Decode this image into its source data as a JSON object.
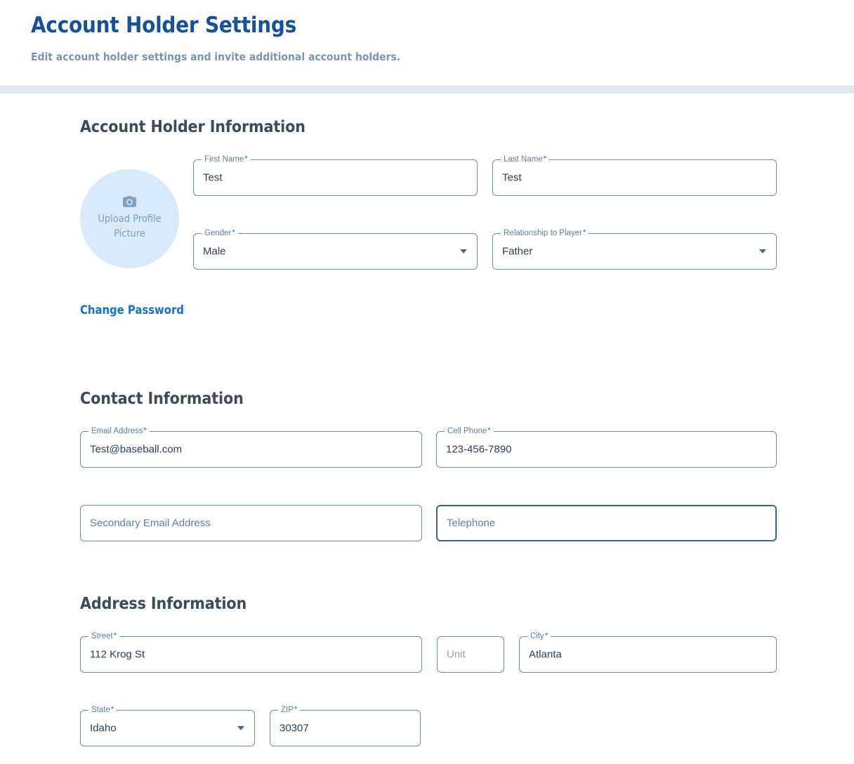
{
  "header": {
    "title": "Account Holder Settings",
    "subtitle": "Edit account holder settings and invite additional account holders.",
    "title_color": "#16529b",
    "subtitle_color": "#7b93ab",
    "band_color": "#e2e8f1"
  },
  "sections": {
    "account_holder": {
      "title": "Account Holder Information"
    },
    "contact": {
      "title": "Contact Information"
    },
    "address": {
      "title": "Address Information"
    }
  },
  "avatar": {
    "caption": "Upload Profile Picture",
    "icon": "camera-icon",
    "bg_color": "#daeafa",
    "text_color": "#7ca0c0"
  },
  "links": {
    "change_password": "Change Password",
    "color": "#1172d4"
  },
  "required_marker": "*",
  "fields": {
    "first_name": {
      "label": "First Name",
      "required": true,
      "value": "Test",
      "placeholder": "",
      "type": "text",
      "focused": false
    },
    "last_name": {
      "label": "Last Name",
      "required": true,
      "value": "Test",
      "placeholder": "",
      "type": "text",
      "focused": false
    },
    "gender": {
      "label": "Gender",
      "required": true,
      "value": "Male",
      "placeholder": "",
      "type": "select",
      "focused": false
    },
    "relationship": {
      "label": "Relationship to Player",
      "required": true,
      "value": "Father",
      "placeholder": "",
      "type": "select",
      "focused": false
    },
    "email": {
      "label": "Email Address",
      "required": true,
      "value": "Test@baseball.com",
      "placeholder": "",
      "type": "text",
      "focused": false
    },
    "cell_phone": {
      "label": "Cell Phone",
      "required": true,
      "value": "123-456-7890",
      "placeholder": "",
      "type": "text",
      "focused": false
    },
    "secondary_email": {
      "label": "",
      "required": false,
      "value": "",
      "placeholder": "Secondary Email Address",
      "type": "text",
      "focused": false
    },
    "telephone": {
      "label": "",
      "required": false,
      "value": "",
      "placeholder": "Telephone",
      "type": "text",
      "focused": true
    },
    "street": {
      "label": "Street",
      "required": true,
      "value": "112 Krog St",
      "placeholder": "",
      "type": "text",
      "focused": false
    },
    "unit": {
      "label": "",
      "required": false,
      "value": "",
      "placeholder": "Unit",
      "type": "text",
      "focused": false
    },
    "city": {
      "label": "City",
      "required": true,
      "value": "Atlanta",
      "placeholder": "",
      "type": "text",
      "focused": false
    },
    "state": {
      "label": "State",
      "required": true,
      "value": "Idaho",
      "placeholder": "",
      "type": "select",
      "focused": false
    },
    "zip": {
      "label": "ZIP",
      "required": true,
      "value": "30307",
      "placeholder": "",
      "type": "text",
      "focused": false
    }
  }
}
